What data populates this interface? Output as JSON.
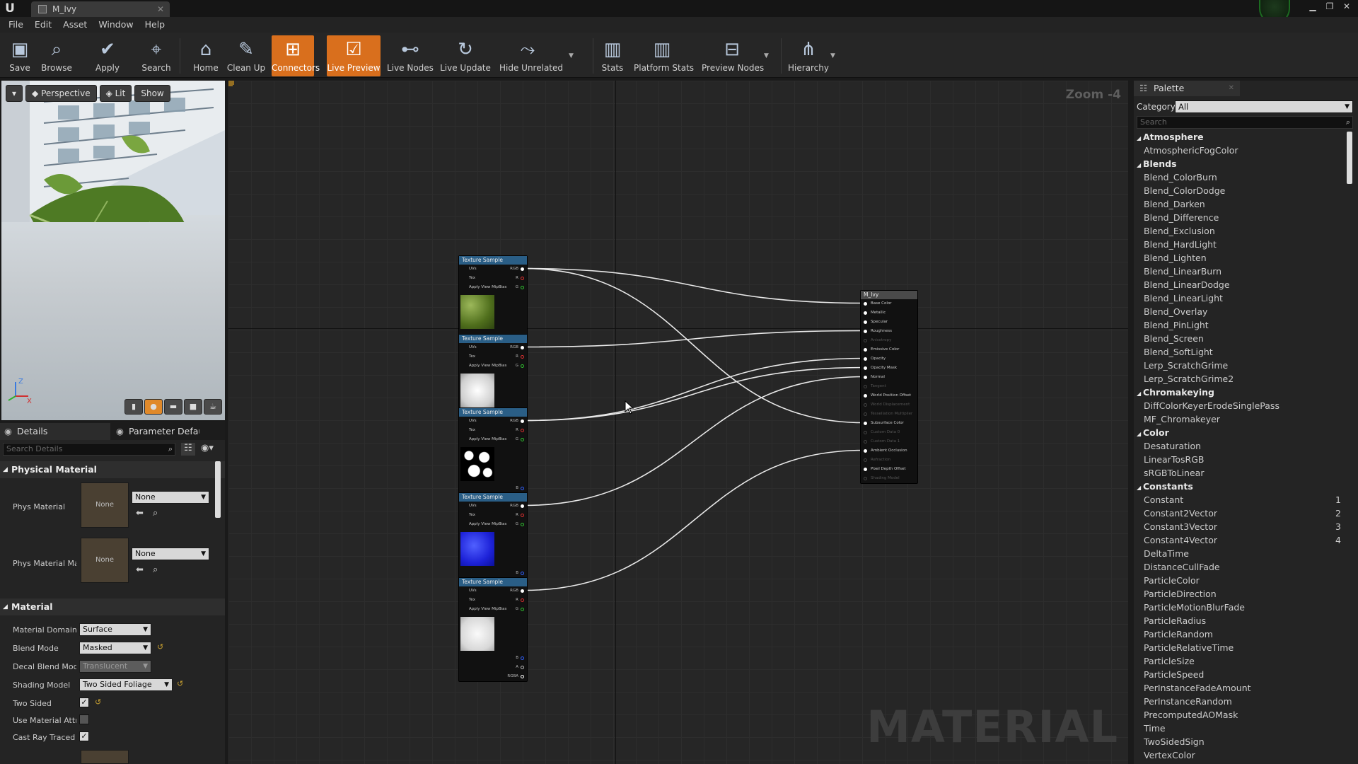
{
  "window": {
    "tab_title": "M_Ivy"
  },
  "menu": [
    "File",
    "Edit",
    "Asset",
    "Window",
    "Help"
  ],
  "toolbar": [
    {
      "label": "Save",
      "icon": "save-icon",
      "active": false
    },
    {
      "label": "Browse",
      "icon": "browse-icon",
      "active": false
    },
    {
      "label": "Apply",
      "icon": "apply-icon",
      "active": false
    },
    {
      "label": "Search",
      "icon": "search-icon",
      "active": false
    },
    {
      "label": "Home",
      "icon": "home-icon",
      "active": false
    },
    {
      "label": "Clean Up",
      "icon": "clean-up-icon",
      "active": false
    },
    {
      "label": "Connectors",
      "icon": "connectors-icon",
      "active": true
    },
    {
      "label": "Live Preview",
      "icon": "live-preview-icon",
      "active": true
    },
    {
      "label": "Live Nodes",
      "icon": "live-nodes-icon",
      "active": false
    },
    {
      "label": "Live Update",
      "icon": "live-update-icon",
      "active": false
    },
    {
      "label": "Hide Unrelated",
      "icon": "hide-unrelated-icon",
      "active": false
    },
    {
      "label": "Stats",
      "icon": "stats-icon",
      "active": false
    },
    {
      "label": "Platform Stats",
      "icon": "platform-stats-icon",
      "active": false
    },
    {
      "label": "Preview Nodes",
      "icon": "preview-nodes-icon",
      "active": false
    },
    {
      "label": "Hierarchy",
      "icon": "hierarchy-icon",
      "active": false
    }
  ],
  "viewport": {
    "perspective": "Perspective",
    "lit": "Lit",
    "show": "Show",
    "axis_z": "Z",
    "axis_x": "X"
  },
  "details": {
    "tab_details": "Details",
    "tab_params": "Parameter Defaults",
    "search_placeholder": "Search Details",
    "section_physical": "Physical Material",
    "phys_material_label": "Phys Material",
    "phys_material_thumb": "None",
    "phys_material_value": "None",
    "phys_material_mask_label": "Phys Material Mask",
    "phys_material_mask_thumb": "None",
    "phys_material_mask_value": "None",
    "section_material": "Material",
    "material_domain_label": "Material Domain",
    "material_domain_value": "Surface",
    "blend_mode_label": "Blend Mode",
    "blend_mode_value": "Masked",
    "decal_blend_label": "Decal Blend Mode",
    "decal_blend_value": "Translucent",
    "shading_model_label": "Shading Model",
    "shading_model_value": "Two Sided Foliage",
    "two_sided_label": "Two Sided",
    "two_sided_checked": true,
    "use_material_attr_label": "Use Material Attributes",
    "use_material_attr_checked": false,
    "cast_ray_label": "Cast Ray Traced Shadows",
    "cast_ray_checked": true
  },
  "graph": {
    "zoom": "Zoom -4",
    "watermark": "MATERIAL",
    "texture_node_title": "Texture Sample",
    "texture_inputs": [
      "UVs",
      "Tex",
      "Apply View MipBias"
    ],
    "texture_outputs": [
      "RGB",
      "R",
      "G",
      "B",
      "A",
      "RGBA"
    ],
    "texture_previews": [
      "leaf-diffuse",
      "leaf-mask-white",
      "leaf-opacity-mask",
      "leaf-normal-blue",
      "leaf-sss-white"
    ],
    "main_node_title": "M_Ivy",
    "main_inputs": [
      {
        "label": "Base Color",
        "on": true
      },
      {
        "label": "Metallic",
        "on": true
      },
      {
        "label": "Specular",
        "on": true
      },
      {
        "label": "Roughness",
        "on": true
      },
      {
        "label": "Anisotropy",
        "on": false
      },
      {
        "label": "Emissive Color",
        "on": true
      },
      {
        "label": "Opacity",
        "on": true
      },
      {
        "label": "Opacity Mask",
        "on": true
      },
      {
        "label": "Normal",
        "on": true
      },
      {
        "label": "Tangent",
        "on": false
      },
      {
        "label": "World Position Offset",
        "on": true
      },
      {
        "label": "World Displacement",
        "on": false
      },
      {
        "label": "Tessellation Multiplier",
        "on": false
      },
      {
        "label": "Subsurface Color",
        "on": true
      },
      {
        "label": "Custom Data 0",
        "on": false
      },
      {
        "label": "Custom Data 1",
        "on": false
      },
      {
        "label": "Ambient Occlusion",
        "on": true
      },
      {
        "label": "Refraction",
        "on": false
      },
      {
        "label": "Pixel Depth Offset",
        "on": true
      },
      {
        "label": "Shading Model",
        "on": false
      }
    ]
  },
  "palette": {
    "tab": "Palette",
    "category_label": "Category:",
    "category_value": "All",
    "search_placeholder": "Search",
    "items": [
      {
        "name": "Atmosphere",
        "cat": true
      },
      {
        "name": "AtmosphericFogColor"
      },
      {
        "name": "Blends",
        "cat": true
      },
      {
        "name": "Blend_ColorBurn"
      },
      {
        "name": "Blend_ColorDodge"
      },
      {
        "name": "Blend_Darken"
      },
      {
        "name": "Blend_Difference"
      },
      {
        "name": "Blend_Exclusion"
      },
      {
        "name": "Blend_HardLight"
      },
      {
        "name": "Blend_Lighten"
      },
      {
        "name": "Blend_LinearBurn"
      },
      {
        "name": "Blend_LinearDodge"
      },
      {
        "name": "Blend_LinearLight"
      },
      {
        "name": "Blend_Overlay"
      },
      {
        "name": "Blend_PinLight"
      },
      {
        "name": "Blend_Screen"
      },
      {
        "name": "Blend_SoftLight"
      },
      {
        "name": "Lerp_ScratchGrime"
      },
      {
        "name": "Lerp_ScratchGrime2"
      },
      {
        "name": "Chromakeying",
        "cat": true
      },
      {
        "name": "DiffColorKeyerErodeSinglePass"
      },
      {
        "name": "MF_Chromakeyer"
      },
      {
        "name": "Color",
        "cat": true
      },
      {
        "name": "Desaturation"
      },
      {
        "name": "LinearTosRGB"
      },
      {
        "name": "sRGBToLinear"
      },
      {
        "name": "Constants",
        "cat": true
      },
      {
        "name": "Constant",
        "key": "1"
      },
      {
        "name": "Constant2Vector",
        "key": "2"
      },
      {
        "name": "Constant3Vector",
        "key": "3"
      },
      {
        "name": "Constant4Vector",
        "key": "4"
      },
      {
        "name": "DeltaTime"
      },
      {
        "name": "DistanceCullFade"
      },
      {
        "name": "ParticleColor"
      },
      {
        "name": "ParticleDirection"
      },
      {
        "name": "ParticleMotionBlurFade"
      },
      {
        "name": "ParticleRadius"
      },
      {
        "name": "ParticleRandom"
      },
      {
        "name": "ParticleRelativeTime"
      },
      {
        "name": "ParticleSize"
      },
      {
        "name": "ParticleSpeed"
      },
      {
        "name": "PerInstanceFadeAmount"
      },
      {
        "name": "PerInstanceRandom"
      },
      {
        "name": "PrecomputedAOMask"
      },
      {
        "name": "Time"
      },
      {
        "name": "TwoSidedSign"
      },
      {
        "name": "VertexColor"
      }
    ]
  }
}
